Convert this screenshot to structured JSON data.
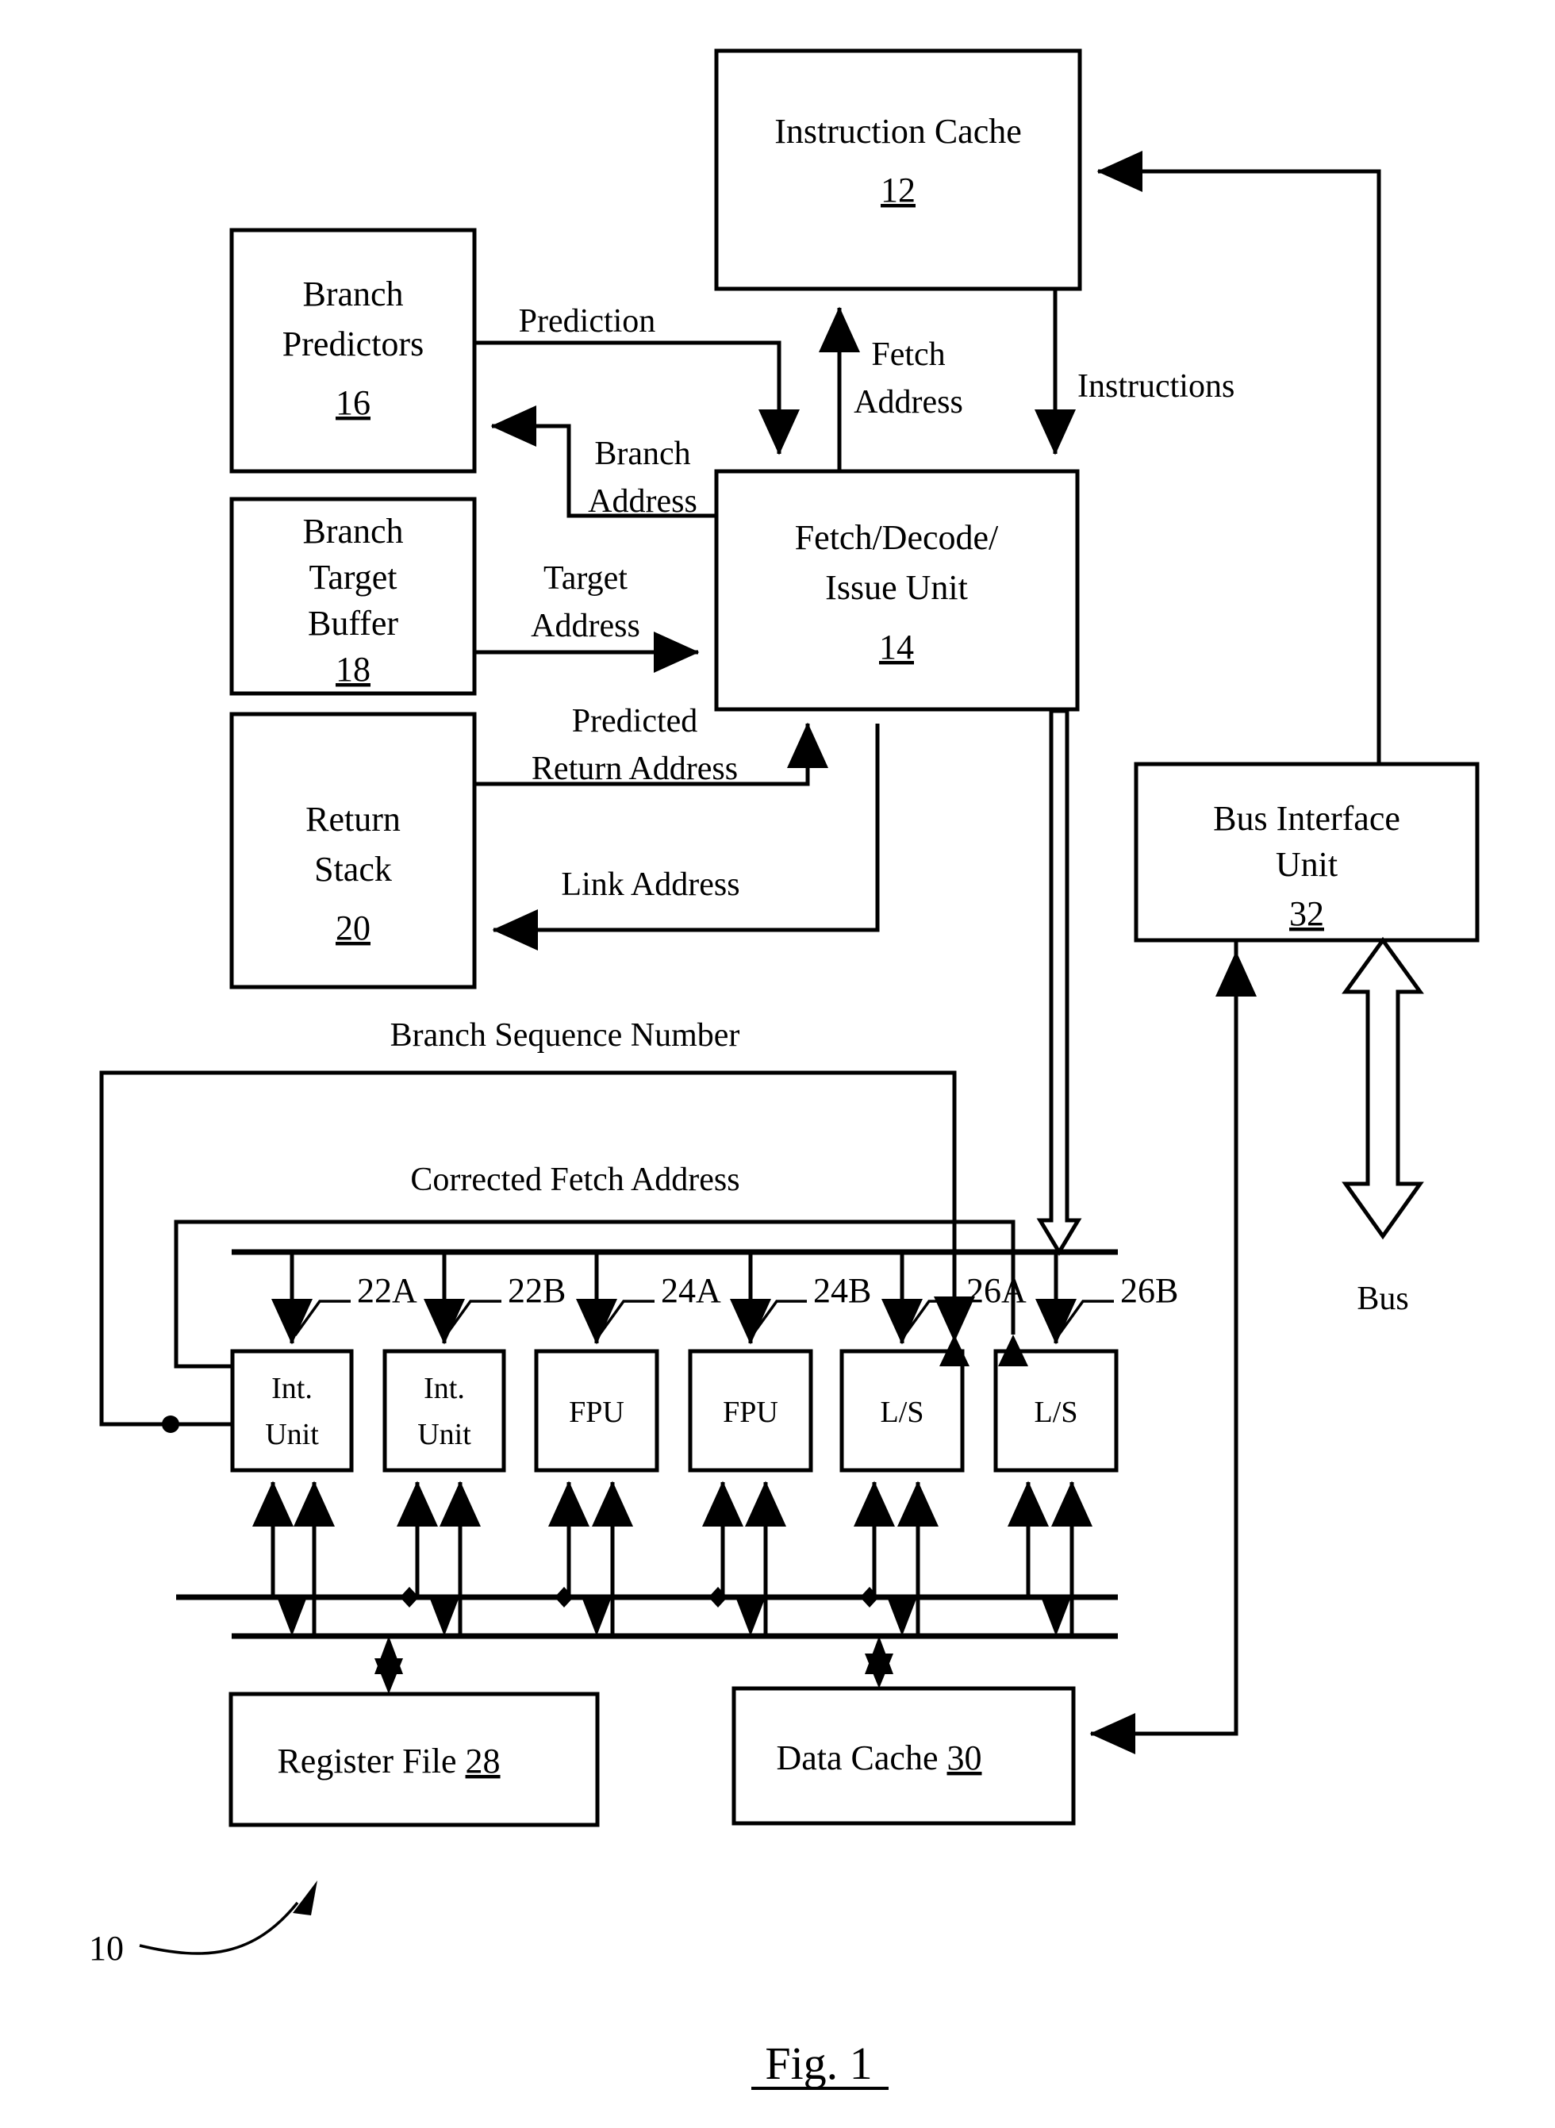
{
  "figure": {
    "caption": "Fig. 1",
    "system_ref": "10"
  },
  "blocks": [
    {
      "id": "instruction-cache",
      "label_lines": [
        "Instruction Cache"
      ],
      "ref": "12"
    },
    {
      "id": "branch-predictors",
      "label_lines": [
        "Branch",
        "Predictors"
      ],
      "ref": "16"
    },
    {
      "id": "branch-target-buffer",
      "label_lines": [
        "Branch",
        "Target",
        "Buffer"
      ],
      "ref": "18"
    },
    {
      "id": "return-stack",
      "label_lines": [
        "Return",
        "Stack"
      ],
      "ref": "20"
    },
    {
      "id": "fetch-decode-issue-unit",
      "label_lines": [
        "Fetch/Decode/",
        "Issue Unit"
      ],
      "ref": "14"
    },
    {
      "id": "bus-interface-unit",
      "label_lines": [
        "Bus Interface",
        "Unit"
      ],
      "ref": "32"
    },
    {
      "id": "register-file",
      "label_lines": [
        "Register File"
      ],
      "ref": "28"
    },
    {
      "id": "data-cache",
      "label_lines": [
        "Data Cache"
      ],
      "ref": "30"
    }
  ],
  "execution_units": [
    {
      "id": "int-unit-a",
      "label_lines": [
        "Int.",
        "Unit"
      ],
      "ref": "22A"
    },
    {
      "id": "int-unit-b",
      "label_lines": [
        "Int.",
        "Unit"
      ],
      "ref": "22B"
    },
    {
      "id": "fpu-a",
      "label_lines": [
        "FPU"
      ],
      "ref": "24A"
    },
    {
      "id": "fpu-b",
      "label_lines": [
        "FPU"
      ],
      "ref": "24B"
    },
    {
      "id": "ls-a",
      "label_lines": [
        "L/S"
      ],
      "ref": "26A"
    },
    {
      "id": "ls-b",
      "label_lines": [
        "L/S"
      ],
      "ref": "26B"
    }
  ],
  "signals": {
    "prediction": "Prediction",
    "fetch_address_l1": "Fetch",
    "fetch_address_l2": "Address",
    "instructions": "Instructions",
    "branch_address_l1": "Branch",
    "branch_address_l2": "Address",
    "target_address_l1": "Target",
    "target_address_l2": "Address",
    "predicted_return_address_l1": "Predicted",
    "predicted_return_address_l2": "Return Address",
    "link_address": "Link Address",
    "branch_sequence_number": "Branch Sequence Number",
    "corrected_fetch_address": "Corrected Fetch Address",
    "bus": "Bus"
  },
  "colors": {
    "ink": "#000000",
    "paper": "#ffffff"
  }
}
